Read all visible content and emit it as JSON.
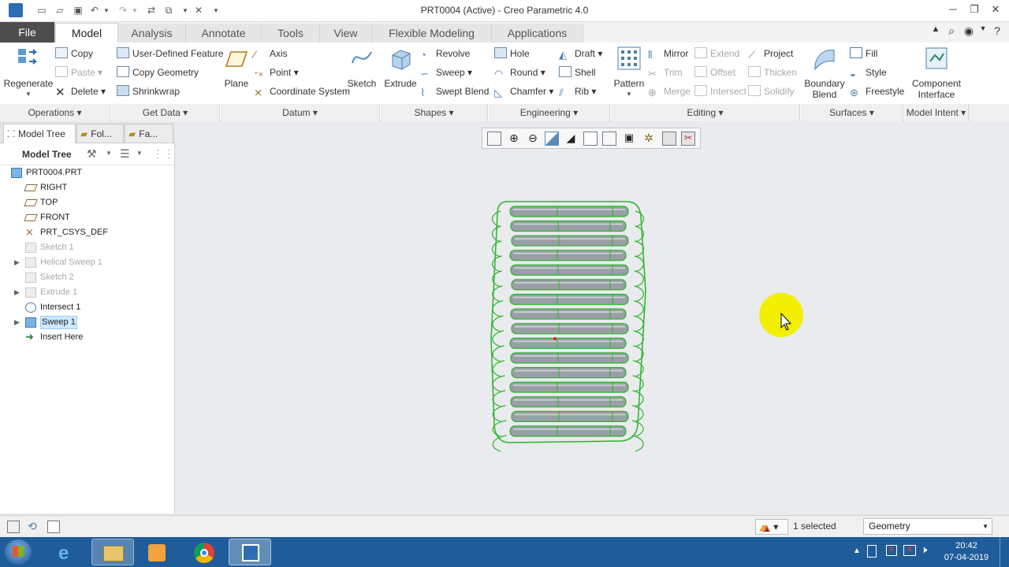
{
  "window": {
    "title": "PRT0004 (Active) - Creo Parametric 4.0"
  },
  "tabs": [
    "File",
    "Model",
    "Analysis",
    "Annotate",
    "Tools",
    "View",
    "Flexible Modeling",
    "Applications"
  ],
  "ribbon": {
    "operations": {
      "regenerate": "Regenerate",
      "copy": "Copy",
      "paste": "Paste",
      "delete": "Delete",
      "group": "Operations"
    },
    "get_data": {
      "udf": "User-Defined Feature",
      "copy_geometry": "Copy Geometry",
      "shrinkwrap": "Shrinkwrap",
      "group": "Get Data"
    },
    "datum": {
      "plane": "Plane",
      "axis": "Axis",
      "point": "Point",
      "csys": "Coordinate System",
      "sketch": "Sketch",
      "group": "Datum"
    },
    "shapes": {
      "extrude": "Extrude",
      "revolve": "Revolve",
      "sweep": "Sweep",
      "swept_blend": "Swept Blend",
      "group": "Shapes"
    },
    "engineering": {
      "hole": "Hole",
      "round": "Round",
      "chamfer": "Chamfer",
      "draft": "Draft",
      "shell": "Shell",
      "rib": "Rib",
      "group": "Engineering"
    },
    "editing": {
      "pattern": "Pattern",
      "mirror": "Mirror",
      "trim": "Trim",
      "merge": "Merge",
      "extend": "Extend",
      "offset": "Offset",
      "intersect": "Intersect",
      "project": "Project",
      "thicken": "Thicken",
      "solidify": "Solidify",
      "group": "Editing"
    },
    "surfaces": {
      "boundary_blend": "Boundary\nBlend",
      "fill": "Fill",
      "style": "Style",
      "freestyle": "Freestyle",
      "group": "Surfaces"
    },
    "model_intent": {
      "component_interface": "Component\nInterface",
      "group": "Model Intent"
    }
  },
  "left_panel": {
    "tabs": [
      "Model Tree",
      "Fol...",
      "Fa..."
    ],
    "header": "Model Tree",
    "tree": [
      {
        "label": "PRT0004.PRT",
        "state": "normal"
      },
      {
        "label": "RIGHT",
        "state": "normal"
      },
      {
        "label": "TOP",
        "state": "normal"
      },
      {
        "label": "FRONT",
        "state": "normal"
      },
      {
        "label": "PRT_CSYS_DEF",
        "state": "normal"
      },
      {
        "label": "Sketch 1",
        "state": "suppressed"
      },
      {
        "label": "Helical Sweep 1",
        "state": "suppressed"
      },
      {
        "label": "Sketch 2",
        "state": "suppressed"
      },
      {
        "label": "Extrude 1",
        "state": "suppressed"
      },
      {
        "label": "Intersect 1",
        "state": "normal"
      },
      {
        "label": "Sweep 1",
        "state": "selected"
      },
      {
        "label": "Insert Here",
        "state": "normal"
      }
    ]
  },
  "status": {
    "selected": "1 selected",
    "filter": "Geometry"
  },
  "taskbar": {
    "time": "20:42",
    "date": "07-04-2019"
  },
  "colors": {
    "edge_green": "#2bb52b",
    "tube_gray": "#9a9ea6",
    "cursor_highlight": "#f3ef00"
  }
}
